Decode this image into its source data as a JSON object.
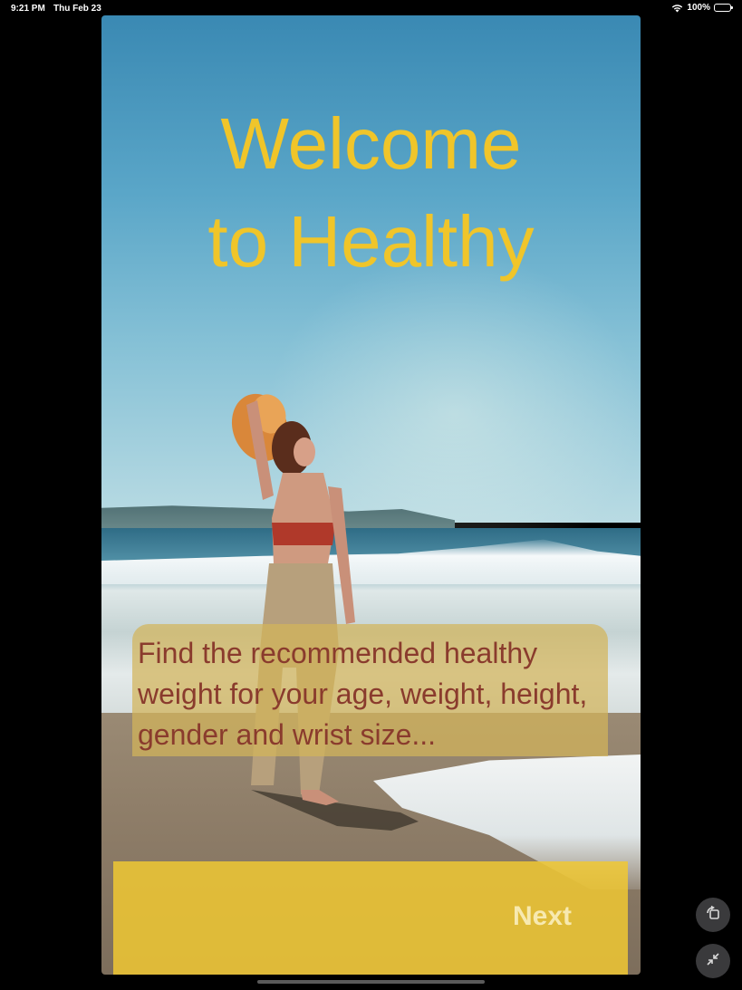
{
  "status_bar": {
    "time": "9:21 PM",
    "date": "Thu Feb 23",
    "battery": "100%",
    "icons": [
      "wifi-icon",
      "battery-icon"
    ]
  },
  "welcome": {
    "title": "Welcome\nto Healthy",
    "description": "Find the recommended healthy weight for your age, weight, height, gender and wrist size...",
    "next_label": "Next"
  },
  "side_controls": {
    "icons": [
      "rotate-screen-icon",
      "collapse-arrows-icon"
    ]
  },
  "colors": {
    "title": "#f0c52a",
    "description_text": "#8a3b2d",
    "description_bg": "#d2b45a",
    "next_bg": "#f0c832",
    "next_text": "#f7e9b0"
  }
}
